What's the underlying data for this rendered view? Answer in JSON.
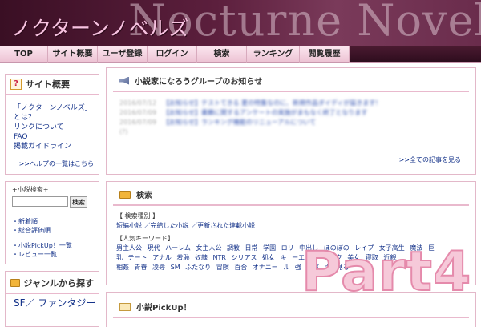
{
  "header": {
    "site_title": "ノクターンノベルズ",
    "bg_text": "Nocturne Novels"
  },
  "nav": {
    "items": [
      "TOP",
      "サイト概要",
      "ユーザ登録",
      "ログイン",
      "検索",
      "ランキング",
      "閲覧履歴"
    ]
  },
  "sidebar": {
    "overview": {
      "title": "サイト概要",
      "links": [
        "「ノクターンノベルズ」とは？",
        "リンクについて",
        "FAQ",
        "掲載ガイドライン"
      ],
      "help_link": ">>ヘルプの一覧はこちら"
    },
    "search": {
      "label": "+小説検索+",
      "button": "検索",
      "links": [
        "・新着順",
        "・総合評価順",
        "・小説PickUp！一覧",
        "・レビュー一覧"
      ]
    },
    "genre": {
      "title": "ジャンルから探す",
      "text": "SF／ ファンタジー"
    }
  },
  "main": {
    "news": {
      "title": "小説家になろうグループのお知らせ",
      "items": [
        {
          "date": "2016/07/12",
          "text": "【お知らせ】テストてきる 夏の特集なのに、新規作品ダイディが届きます!"
        },
        {
          "date": "2016/07/09",
          "text": "【お知らせ】書籍に関するアンケートの実施がまもなく終了となります"
        },
        {
          "date": "2016/07/09",
          "text": "【お知らせ】ランキング機能のリニューアルについて"
        }
      ],
      "extra": "(?)",
      "more": ">>全ての記事を見る"
    },
    "search": {
      "title": "検索",
      "type_label": "【 検索種別 】",
      "type_links": "短編小説 ／完結した小説 ／更新された連載小説",
      "keyword_label": "【人気キーワード】",
      "keywords_1": "男主人公 現代 ハーレム 女主人公 調教 日常 学園 ロリ 中出し ほのぼの レイプ 女子高生 魔法 巨",
      "keywords_2": "乳 チート アナル 羞恥 奴隷 NTR シリアス 処女 キ ーエンド ダーク 美女 寝取 近親",
      "keywords_3": "相姦 青春 凌辱 SM ふたなり 冒険 百合 オナニー ル 強 人気 キ 見る"
    },
    "pickup": {
      "title": "小説PickUp！"
    }
  },
  "overlay": {
    "text": "Part4"
  }
}
